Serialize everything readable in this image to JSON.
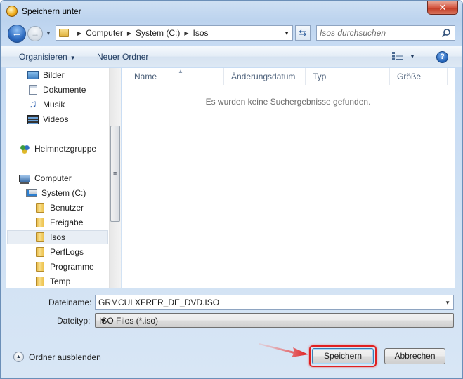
{
  "window": {
    "title": "Speichern unter",
    "close_label": "✕"
  },
  "address": {
    "crumbs": [
      "Computer",
      "System (C:)",
      "Isos"
    ]
  },
  "search": {
    "placeholder": "Isos durchsuchen"
  },
  "toolbar": {
    "organize_label": "Organisieren",
    "new_folder_label": "Neuer Ordner",
    "help_label": "?"
  },
  "nav_pane": {
    "items": [
      {
        "label": "Bilder",
        "icon": "pictures-icon"
      },
      {
        "label": "Dokumente",
        "icon": "documents-icon"
      },
      {
        "label": "Musik",
        "icon": "music-icon"
      },
      {
        "label": "Videos",
        "icon": "videos-icon"
      },
      {
        "label": "Heimnetzgruppe",
        "icon": "homegroup-icon"
      },
      {
        "label": "Computer",
        "icon": "computer-icon"
      },
      {
        "label": "System (C:)",
        "icon": "drive-icon"
      },
      {
        "label": "Benutzer",
        "icon": "folder-icon"
      },
      {
        "label": "Freigabe",
        "icon": "folder-icon"
      },
      {
        "label": "Isos",
        "icon": "folder-icon",
        "selected": true
      },
      {
        "label": "PerfLogs",
        "icon": "folder-icon"
      },
      {
        "label": "Programme",
        "icon": "folder-icon"
      },
      {
        "label": "Temp",
        "icon": "folder-icon"
      }
    ]
  },
  "content": {
    "columns": [
      "Name",
      "Änderungsdatum",
      "Typ",
      "Größe"
    ],
    "empty_message": "Es wurden keine Suchergebnisse gefunden."
  },
  "form": {
    "filename_label": "Dateiname:",
    "filename_value": "GRMCULXFRER_DE_DVD.ISO",
    "filetype_label": "Dateityp:",
    "filetype_value": "ISO Files (*.iso)"
  },
  "footer": {
    "hide_folders_label": "Ordner ausblenden",
    "save_label": "Speichern",
    "cancel_label": "Abbrechen"
  },
  "colors": {
    "accent": "#3c7fb1",
    "highlight": "#e02020"
  }
}
